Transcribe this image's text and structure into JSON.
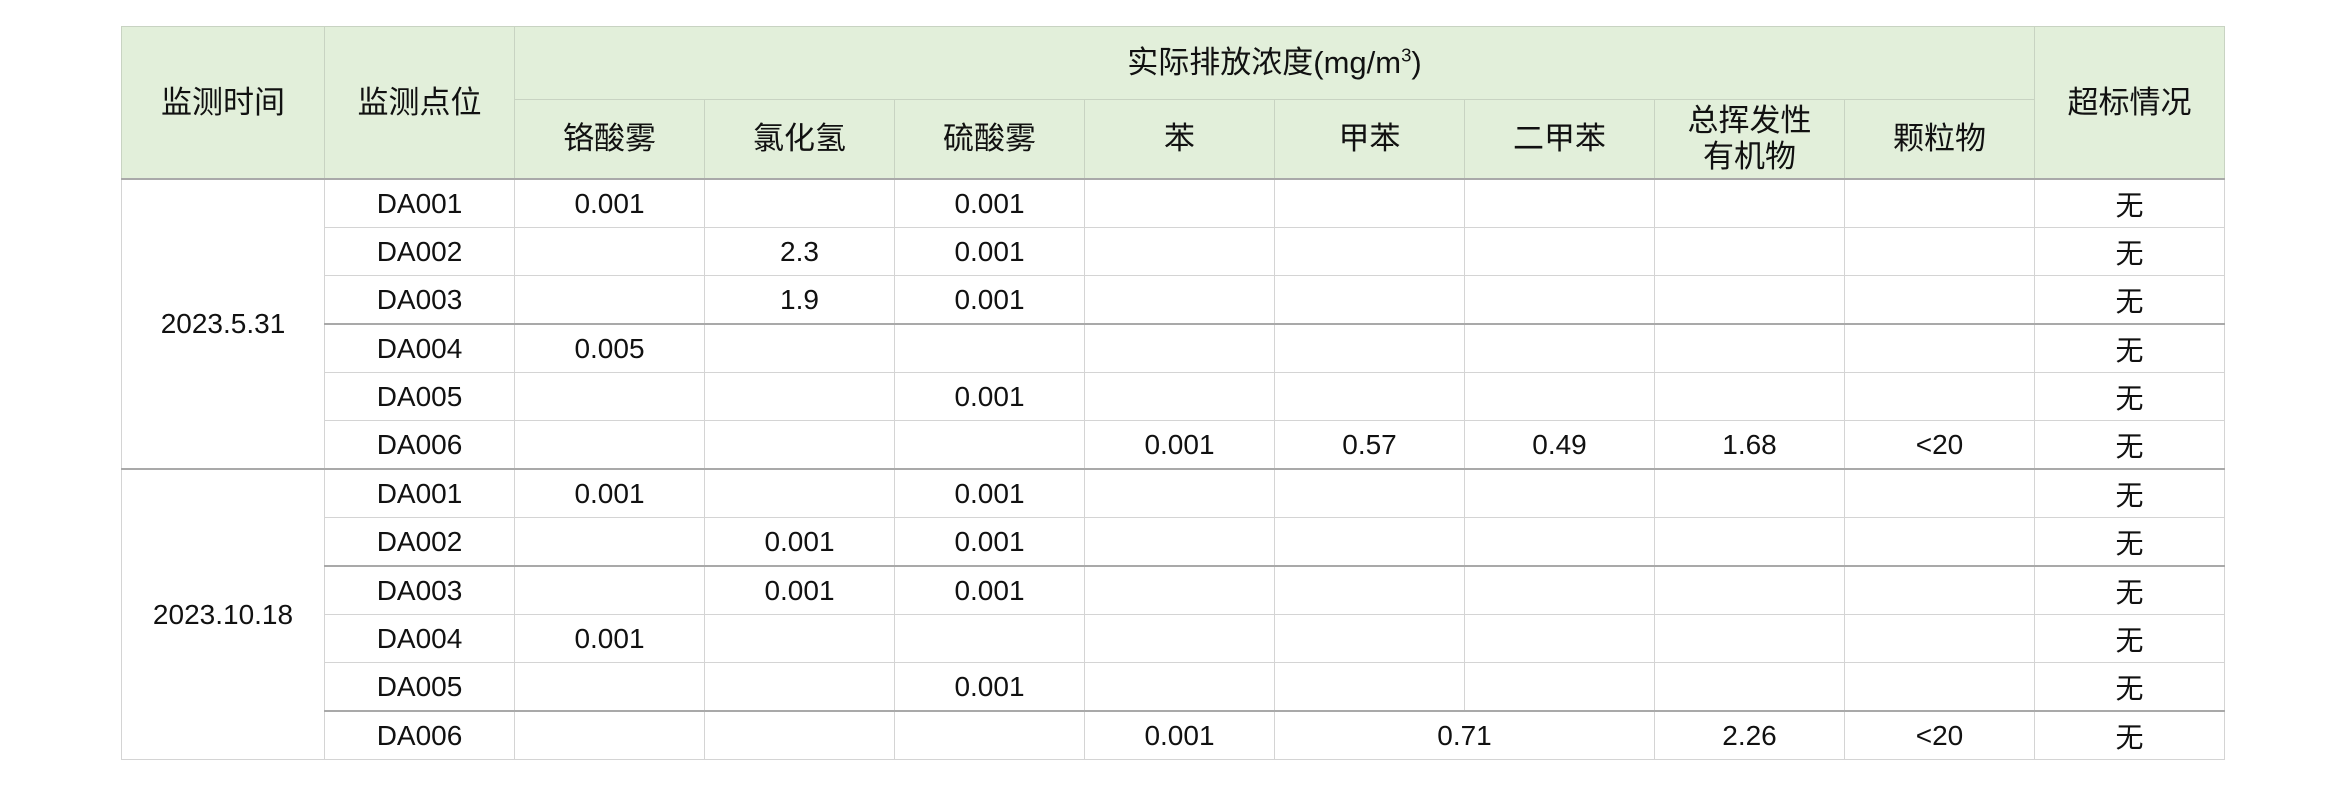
{
  "header": {
    "time": "监测时间",
    "point": "监测点位",
    "group": "实际排放浓度(mg/m",
    "group_sup": "3",
    "group_close": ")",
    "pollutants": [
      "铬酸雾",
      "氯化氢",
      "硫酸雾",
      "苯",
      "甲苯",
      "二甲苯",
      "总挥发性\n有机物",
      "颗粒物"
    ],
    "exceed": "超标情况"
  },
  "groups": [
    {
      "date": "2023.5.31",
      "rows": [
        {
          "point": "DA001",
          "cr": "0.001",
          "hcl": "",
          "h2so4": "0.001",
          "benzene": "",
          "toluene": "",
          "xylene": "",
          "voc": "",
          "pm": "",
          "exceed": "无"
        },
        {
          "point": "DA002",
          "cr": "",
          "hcl": "2.3",
          "h2so4": "0.001",
          "benzene": "",
          "toluene": "",
          "xylene": "",
          "voc": "",
          "pm": "",
          "exceed": "无"
        },
        {
          "point": "DA003",
          "cr": "",
          "hcl": "1.9",
          "h2so4": "0.001",
          "benzene": "",
          "toluene": "",
          "xylene": "",
          "voc": "",
          "pm": "",
          "exceed": "无"
        },
        {
          "point": "DA004",
          "cr": "0.005",
          "hcl": "",
          "h2so4": "",
          "benzene": "",
          "toluene": "",
          "xylene": "",
          "voc": "",
          "pm": "",
          "exceed": "无"
        },
        {
          "point": "DA005",
          "cr": "",
          "hcl": "",
          "h2so4": "0.001",
          "benzene": "",
          "toluene": "",
          "xylene": "",
          "voc": "",
          "pm": "",
          "exceed": "无"
        },
        {
          "point": "DA006",
          "cr": "",
          "hcl": "",
          "h2so4": "",
          "benzene": "0.001",
          "toluene": "0.57",
          "xylene": "0.49",
          "voc": "1.68",
          "pm": "<20",
          "exceed": "无"
        }
      ]
    },
    {
      "date": "2023.10.18",
      "rows": [
        {
          "point": "DA001",
          "cr": "0.001",
          "hcl": "",
          "h2so4": "0.001",
          "benzene": "",
          "toluene": "",
          "xylene": "",
          "voc": "",
          "pm": "",
          "exceed": "无"
        },
        {
          "point": "DA002",
          "cr": "",
          "hcl": "0.001",
          "h2so4": "0.001",
          "benzene": "",
          "toluene": "",
          "xylene": "",
          "voc": "",
          "pm": "",
          "exceed": "无"
        },
        {
          "point": "DA003",
          "cr": "",
          "hcl": "0.001",
          "h2so4": "0.001",
          "benzene": "",
          "toluene": "",
          "xylene": "",
          "voc": "",
          "pm": "",
          "exceed": "无"
        },
        {
          "point": "DA004",
          "cr": "0.001",
          "hcl": "",
          "h2so4": "",
          "benzene": "",
          "toluene": "",
          "xylene": "",
          "voc": "",
          "pm": "",
          "exceed": "无"
        },
        {
          "point": "DA005",
          "cr": "",
          "hcl": "",
          "h2so4": "0.001",
          "benzene": "",
          "toluene": "",
          "xylene": "",
          "voc": "",
          "pm": "",
          "exceed": "无"
        },
        {
          "point": "DA006",
          "cr": "",
          "hcl": "",
          "h2so4": "",
          "benzene": "0.001",
          "toluene_xylene": "0.71",
          "voc": "2.26",
          "pm": "<20",
          "exceed": "无"
        }
      ]
    }
  ]
}
